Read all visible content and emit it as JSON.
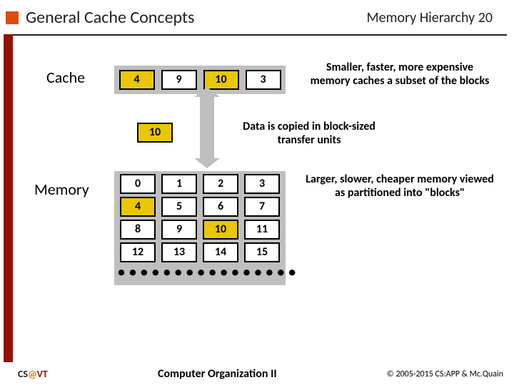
{
  "header": {
    "title": "General Cache Concepts",
    "chapter": "Memory Hierarchy",
    "slide_number": "20"
  },
  "labels": {
    "cache": "Cache",
    "memory": "Memory"
  },
  "cache_cells": [
    "4",
    "9",
    "10",
    "3"
  ],
  "transfer_block": "10",
  "memory_cells": [
    [
      "0",
      "1",
      "2",
      "3"
    ],
    [
      "4",
      "5",
      "6",
      "7"
    ],
    [
      "8",
      "9",
      "10",
      "11"
    ],
    [
      "12",
      "13",
      "14",
      "15"
    ]
  ],
  "captions": {
    "cache": "Smaller, faster, more expensive memory caches a subset of the blocks",
    "transfer": "Data is copied in block-sized transfer units",
    "memory": "Larger, slower, cheaper memory viewed as partitioned into \"blocks\""
  },
  "footer": {
    "school_cs": "CS",
    "school_at": "@",
    "school_vt": "VT",
    "course": "Computer Organization II",
    "copyright": "© 2005-2015 CS:APP & Mc.Quain"
  }
}
